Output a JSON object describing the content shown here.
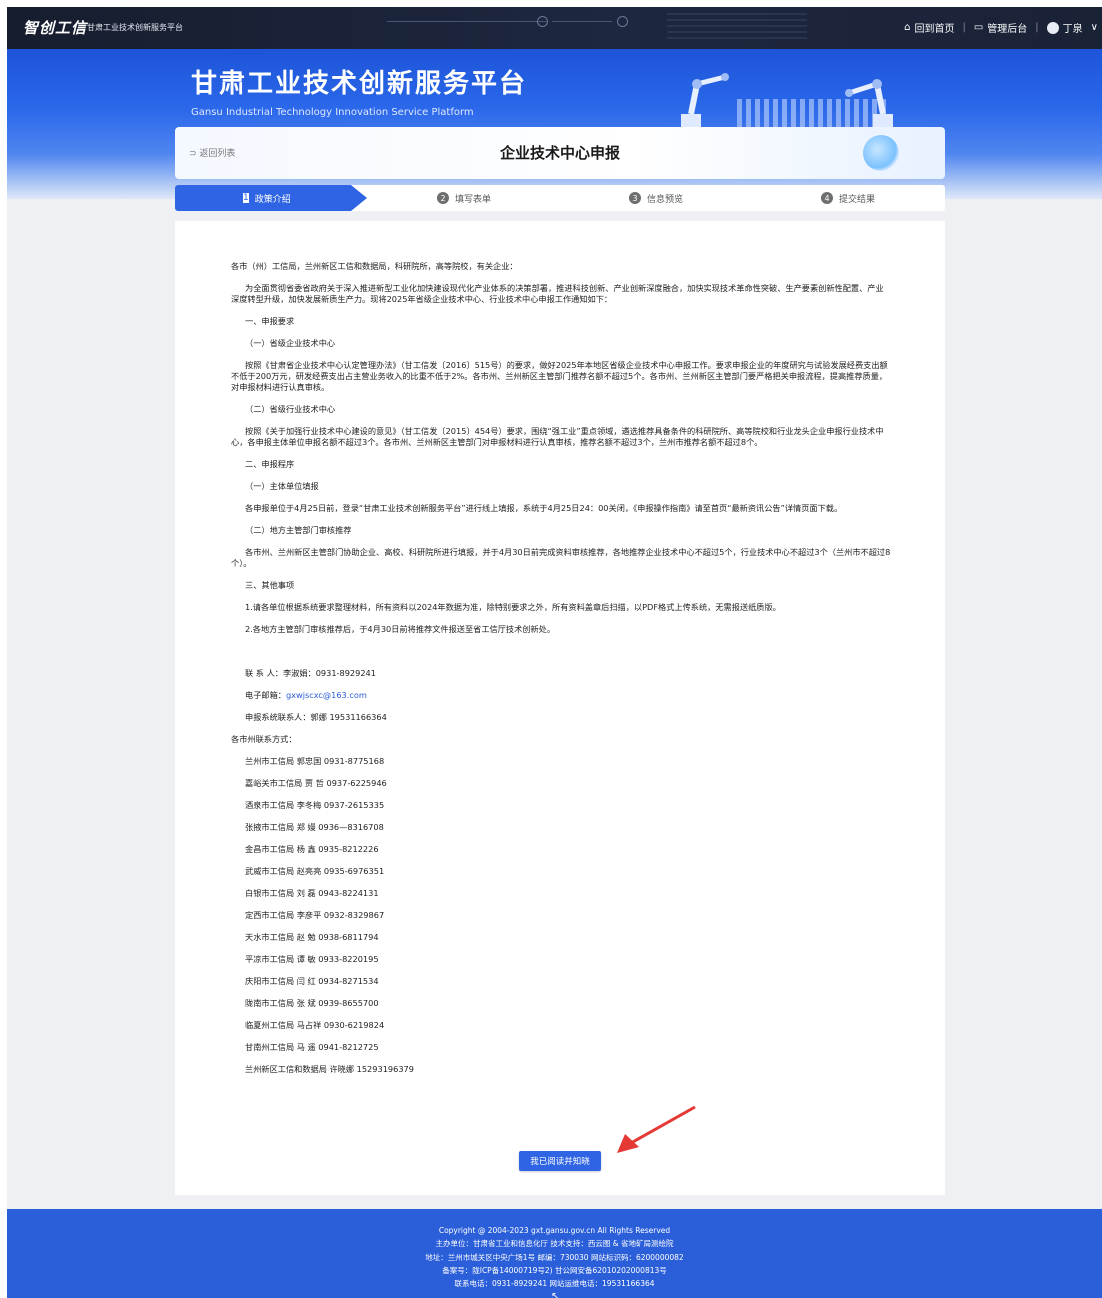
{
  "header": {
    "logo": "智创工信",
    "logo_sub": "甘肃工业技术创新服务平台",
    "nav": {
      "home": "回到首页",
      "admin": "管理后台",
      "user": "丁泉"
    }
  },
  "banner": {
    "title": "甘肃工业技术创新服务平台",
    "subtitle": "Gansu Industrial Technology Innovation Service Platform"
  },
  "page": {
    "back_label": "返回列表",
    "title": "企业技术中心申报"
  },
  "steps": [
    {
      "num": "1",
      "label": "政策介绍"
    },
    {
      "num": "2",
      "label": "填写表单"
    },
    {
      "num": "3",
      "label": "信息预览"
    },
    {
      "num": "4",
      "label": "提交结果"
    }
  ],
  "notice": {
    "salutation": "各市（州）工信局，兰州新区工信和数据局，科研院所，高等院校，有关企业：",
    "intro": "为全面贯彻省委省政府关于深入推进新型工业化加快建设现代化产业体系的决策部署，推进科技创新、产业创新深度融合，加快实现技术革命性突破、生产要素创新性配置、产业深度转型升级，加快发展新质生产力。现将2025年省级企业技术中心、行业技术中心申报工作通知如下：",
    "s1": "一、申报要求",
    "s1_1": "（一）省级企业技术中心",
    "s1_1_text": "按照《甘肃省企业技术中心认定管理办法》（甘工信发〔2016〕515号）的要求，做好2025年本地区省级企业技术中心申报工作。要求申报企业的年度研究与试验发展经费支出额不低于200万元，研发经费支出占主营业务收入的比重不低于2%。各市州、兰州新区主管部门推荐名额不超过5个。各市州、兰州新区主管部门要严格把关申报流程，提高推荐质量，对申报材料进行认真审核。",
    "s1_2": "（二）省级行业技术中心",
    "s1_2_text": "按照《关于加强行业技术中心建设的意见》（甘工信发〔2015〕454号）要求，围绕“强工业”重点领域，遴选推荐具备条件的科研院所、高等院校和行业龙头企业申报行业技术中心，各申报主体单位申报名额不超过3个。各市州、兰州新区主管部门对申报材料进行认真审核，推荐名额不超过3个，兰州市推荐名额不超过8个。",
    "s2": "二、申报程序",
    "s2_1": "（一）主体单位填报",
    "s2_1_text": "各申报单位于4月25日前，登录“甘肃工业技术创新服务平台”进行线上填报，系统于4月25日24：00关闭，《申报操作指南》请至首页“最新资讯公告”详情页面下载。",
    "s2_2": "（二）地方主管部门审核推荐",
    "s2_2_text": "各市州、兰州新区主管部门协助企业、高校、科研院所进行填报，并于4月30日前完成资料审核推荐，各地推荐企业技术中心不超过5个，行业技术中心不超过3个（兰州市不超过8个）。",
    "s3": "三、其他事项",
    "s3_1": "1.请各单位根据系统要求整理材料，所有资料以2024年数据为准，除特别要求之外，所有资料盖章后扫描，以PDF格式上传系统，无需报送纸质版。",
    "s3_2": "2.各地方主管部门审核推荐后，于4月30日前将推荐文件报送至省工信厅技术创新处。",
    "contact_person": "联 系 人：李淑娟：0931-8929241",
    "email_label": "电子邮箱：",
    "email": "gxwjscxc@163.com",
    "system_contact": "申报系统联系人：郭娜 19531166364",
    "city_contacts_title": "各市州联系方式：",
    "city_contacts": [
      "兰州市工信局  郭忠国 0931-8775168",
      "嘉峪关市工信局 贾 哲 0937-6225946",
      "酒泉市工信局  李冬梅 0937-2615335",
      "张掖市工信局  郑 嫚 0936—8316708",
      "金昌市工信局  杨 鑫 0935-8212226",
      "武威市工信局  赵亮亮 0935-6976351",
      "白银市工信局  刘 磊 0943-8224131",
      "定西市工信局  李彦平 0932-8329867",
      "天水市工信局  赵 勉 0938-6811794",
      "平凉市工信局  谭 敏 0933-8220195",
      "庆阳市工信局  闫 红 0934-8271534",
      "陇南市工信局  张 斌 0939-8655700",
      "临夏州工信局  马占祥 0930-6219824",
      "甘南州工信局  马 遥 0941-8212725",
      "兰州新区工信和数据局 许晓娜 15293196379"
    ]
  },
  "ack_button": "我已阅读并知晓",
  "footer": {
    "copyright": "Copyright @ 2004-2023 gxt.gansu.gov.cn All Rights Reserved",
    "sponsor": "主办单位：甘肃省工业和信息化厅 技术支持：西云图 & 省地矿局测绘院",
    "address": "地址：兰州市城关区中央广场1号 邮编：730030 网站标识码：6200000082",
    "record": "备案号：陇ICP备14000719号2) 甘公网安备62010202000813号",
    "phone": "联系电话：0931-8929241 网站运维电话：19531166364"
  },
  "colors": {
    "primary": "#2f65e4",
    "footer": "#2b5fd9",
    "topbar": "#1b2438"
  }
}
